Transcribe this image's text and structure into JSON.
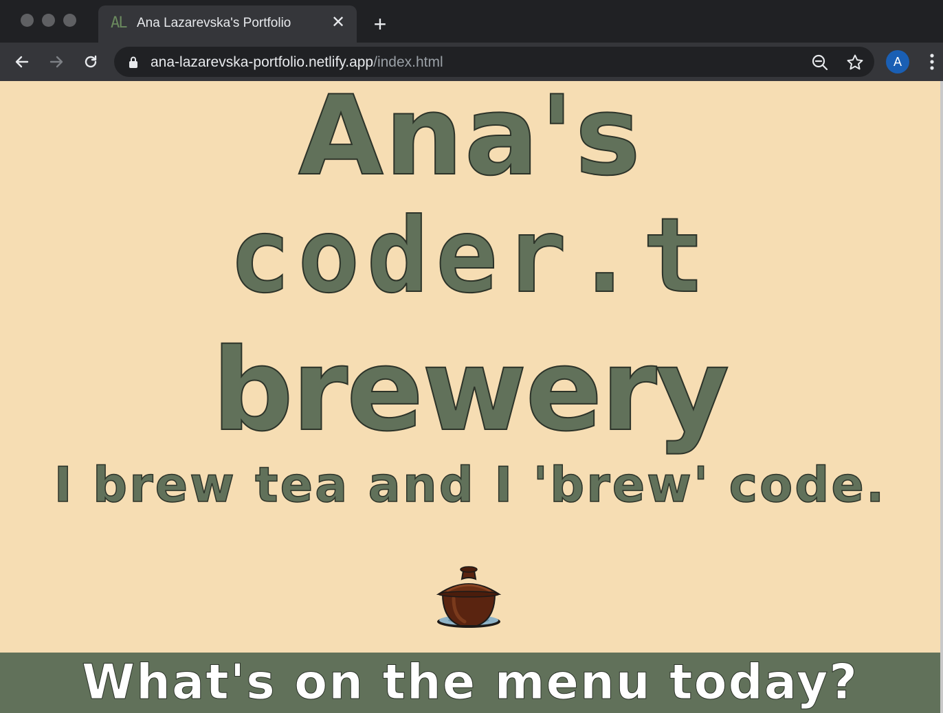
{
  "browser": {
    "tab": {
      "favicon_text": "AL",
      "title": "Ana Lazarevska's Portfolio"
    },
    "address": {
      "host": "ana-lazarevska-portfolio.netlify.app",
      "path": "/index.html"
    },
    "profile_initial": "A",
    "icons": {
      "back": "back-arrow-icon",
      "forward": "forward-arrow-icon",
      "reload": "reload-icon",
      "lock": "lock-icon",
      "zoom": "zoom-out-icon",
      "bookmark": "star-icon",
      "menu": "kebab-menu-icon"
    },
    "colors": {
      "chrome_dark": "#202124",
      "chrome_toolbar": "#35363a",
      "avatar": "#1a5fb4"
    }
  },
  "page": {
    "hero": {
      "line1": "Ana's",
      "line2": "coder.t",
      "line3": "brewery"
    },
    "tagline": "I brew tea and I 'brew' code.",
    "illustration": "teacup-gaiwan-icon",
    "menu_banner": "What's on the menu today?",
    "colors": {
      "background": "#f6ddb3",
      "accent_green": "#61715a",
      "banner_text": "#ffffff"
    }
  }
}
